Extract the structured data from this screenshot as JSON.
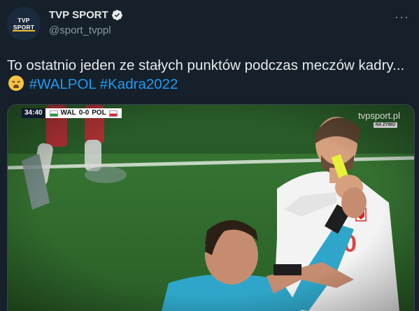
{
  "tweet": {
    "avatar_logo_text": "TVP SPORT",
    "author_name": "TVP SPORT",
    "verified_icon": "verified-badge-icon",
    "handle": "@sport_tvppl",
    "more_icon": "more-options-icon",
    "text_line": "To ostatnio jeden ze stałych punktów podczas meczów kadry...",
    "emoji": "weary-face-emoji",
    "hashtags": [
      "#WALPOL",
      "#Kadra2022"
    ]
  },
  "media": {
    "scorebug": {
      "time": "34:40",
      "home": "WAL",
      "score": "0-0",
      "away": "POL"
    },
    "watermark": "tvpsport.pl",
    "live_badge": "NA ŻYWO"
  },
  "colors": {
    "background": "#15202b",
    "text": "#e7e9ea",
    "muted": "#8b98a5",
    "link": "#1d9bf0",
    "pitch": "#2c6b2c"
  }
}
